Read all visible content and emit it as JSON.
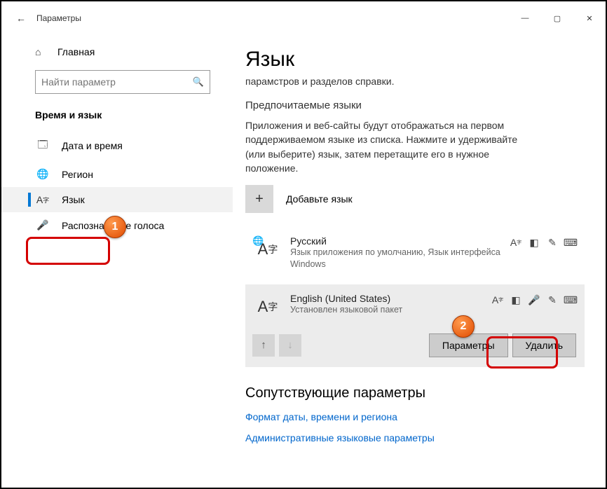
{
  "titlebar": {
    "title": "Параметры"
  },
  "sidebar": {
    "home": "Главная",
    "search_placeholder": "Найти параметр",
    "category": "Время и язык",
    "items": [
      {
        "label": "Дата и время"
      },
      {
        "label": "Регион"
      },
      {
        "label": "Язык"
      },
      {
        "label": "Распознавание голоса"
      }
    ]
  },
  "page": {
    "title": "Язык",
    "truncated_top": "парамстров и разделов справки.",
    "preferred_heading": "Предпочитаемые языки",
    "preferred_desc": "Приложения и веб-сайты будут отображаться на первом поддерживаемом языке из списка. Нажмите и удерживайте (или выберите) язык, затем перетащите его в нужное положение.",
    "add_label": "Добавьте язык",
    "languages": [
      {
        "name": "Русский",
        "sub": "Язык приложения по умолчанию, Язык интерфейса Windows"
      },
      {
        "name": "English (United States)",
        "sub": "Установлен языковой пакет"
      }
    ],
    "btn_options": "Параметры",
    "btn_remove": "Удалить",
    "related_heading": "Сопутствующие параметры",
    "link1": "Формат даты, времени и региона",
    "link2": "Административные языковые параметры"
  },
  "annotations": {
    "badge1": "1",
    "badge2": "2"
  }
}
